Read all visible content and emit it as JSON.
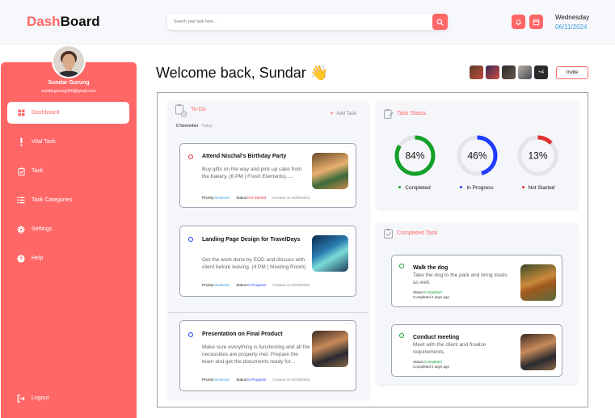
{
  "header": {
    "logo_part1": "Dash",
    "logo_part2": "Board",
    "search_placeholder": "Search your task here...",
    "day": "Wednesday",
    "date": "06/11/2024"
  },
  "sidebar": {
    "user_name": "Sundar Gurung",
    "user_email": "sundargurung360@gmail.com",
    "items": [
      {
        "label": "Dashboard"
      },
      {
        "label": "Vital Task"
      },
      {
        "label": "Task"
      },
      {
        "label": "Task Categories"
      },
      {
        "label": "Settings"
      },
      {
        "label": "Help"
      }
    ],
    "logout": "Logout"
  },
  "main": {
    "welcome": "Welcome back, Sundar",
    "welcome_emoji": "👋",
    "team_more": "+4",
    "invite": "Invite"
  },
  "todo": {
    "title": "To-Do",
    "add_task": "Add Task",
    "date": "6 November",
    "today": "Today",
    "tasks": [
      {
        "title": "Attend Nischal's Birthday Party",
        "desc": "Buy gifts on the way and pick up cake from the bakery. (6 PM | Fresh Elements).....",
        "priority_label": "Priority:",
        "priority": "Moderate",
        "status_label": "Status:",
        "status": "Not Started",
        "created": "Created on:20/06/2023"
      },
      {
        "title": "Landing Page Design for TravelDays",
        "desc": "Get the work done by EOD and discuss with client before leaving. (4 PM | Meeting Room)",
        "priority_label": "Priority:",
        "priority": "Moderate",
        "status_label": "Status:",
        "status": "In Progress",
        "created": "Created on:20/06/2023"
      },
      {
        "title": "Presentation on Final Product",
        "desc": "Make sure everything is functioning and all the necessities are properly met. Prepare the team and get the documents ready for...",
        "priority_label": "Priority:",
        "priority": "Moderate",
        "status_label": "Status:",
        "status": "In Progress",
        "created": "Created on:20/06/2023"
      }
    ]
  },
  "task_status": {
    "title": "Task Status",
    "stats": [
      {
        "value": "84%",
        "fraction": 0.84,
        "label": "Completed",
        "color": "#12a02a"
      },
      {
        "value": "46%",
        "fraction": 0.46,
        "label": "In Progress",
        "color": "#1f3cff"
      },
      {
        "value": "13%",
        "fraction": 0.13,
        "label": "Not Started",
        "color": "#e03131"
      }
    ]
  },
  "completed": {
    "title": "Completed Task",
    "tasks": [
      {
        "title": "Walk the dog",
        "desc": "Take the dog to the park and bring treats as well.",
        "status_label": "Status:",
        "status": "Completed",
        "ago": "Completed 2 days ago"
      },
      {
        "title": "Conduct meeting",
        "desc": "Meet with the client and finalize requirements.",
        "status_label": "Status:",
        "status": "Completed",
        "ago": "Completed 2 days ago"
      }
    ]
  },
  "colors": {
    "accent": "#ff6767",
    "completed": "#12a02a",
    "in_progress": "#1f3cff",
    "not_started": "#e03131",
    "date_blue": "#3aa0e0"
  },
  "icons": {
    "search": "search-icon",
    "bell": "bell-icon",
    "calendar": "calendar-icon",
    "dashboard": "dashboard-icon",
    "vital": "exclamation-icon",
    "task": "task-check-icon",
    "categories": "list-icon",
    "settings": "gear-icon",
    "help": "help-icon",
    "logout": "logout-icon"
  }
}
